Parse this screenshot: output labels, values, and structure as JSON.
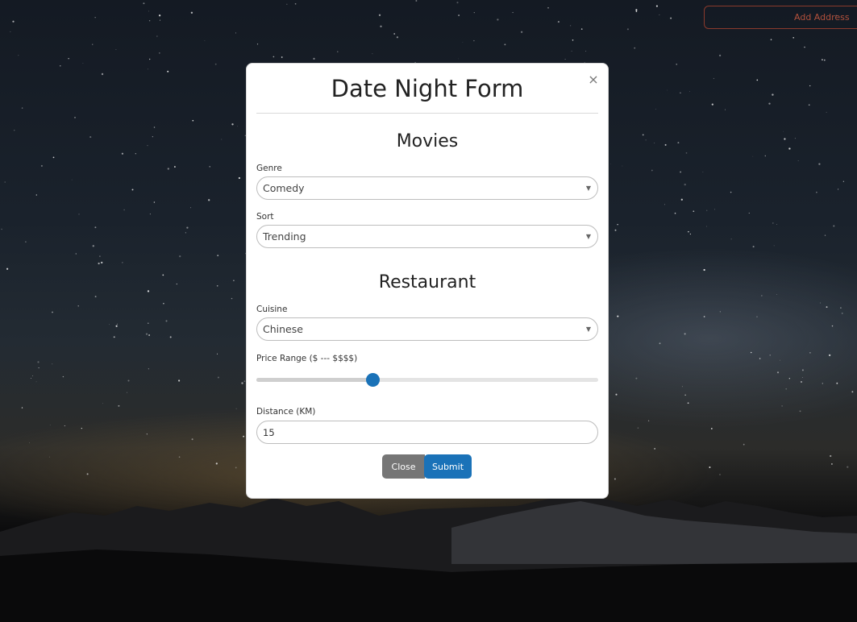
{
  "header": {
    "add_address_label": "Add Address"
  },
  "modal": {
    "title": "Date Night Form",
    "close_glyph": "×",
    "movies": {
      "heading": "Movies",
      "genre_label": "Genre",
      "genre_value": "Comedy",
      "sort_label": "Sort",
      "sort_value": "Trending"
    },
    "restaurant": {
      "heading": "Restaurant",
      "cuisine_label": "Cuisine",
      "cuisine_value": "Chinese",
      "price_label": "Price Range ($ --- $$$$)",
      "price_fraction": 0.34,
      "distance_label": "Distance (KM)",
      "distance_value": "15"
    },
    "buttons": {
      "close_label": "Close",
      "submit_label": "Submit"
    },
    "caret_glyph": "▼"
  },
  "colors": {
    "accent": "#1a72b8",
    "close_button": "#767676",
    "add_address_border": "#8a3a2c"
  }
}
